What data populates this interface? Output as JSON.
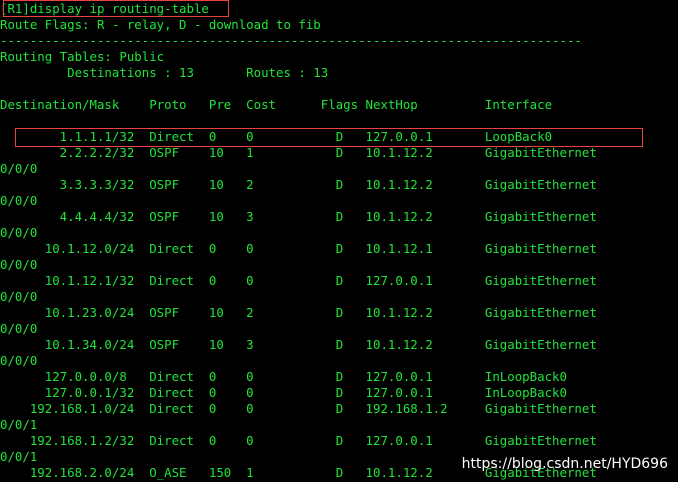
{
  "terminal": {
    "lines": [
      "[R1]display ip routing-table",
      "Route Flags: R - relay, D - download to fib",
      "------------------------------------------------------------------------------",
      "Routing Tables: Public",
      "         Destinations : 13       Routes : 13",
      "",
      "Destination/Mask    Proto   Pre  Cost      Flags NextHop         Interface",
      "",
      "        1.1.1.1/32  Direct  0    0           D   127.0.0.1       LoopBack0",
      "        2.2.2.2/32  OSPF    10   1           D   10.1.12.2       GigabitEthernet",
      "0/0/0",
      "        3.3.3.3/32  OSPF    10   2           D   10.1.12.2       GigabitEthernet",
      "0/0/0",
      "        4.4.4.4/32  OSPF    10   3           D   10.1.12.2       GigabitEthernet",
      "0/0/0",
      "      10.1.12.0/24  Direct  0    0           D   10.1.12.1       GigabitEthernet",
      "0/0/0",
      "      10.1.12.1/32  Direct  0    0           D   127.0.0.1       GigabitEthernet",
      "0/0/0",
      "      10.1.23.0/24  OSPF    10   2           D   10.1.12.2       GigabitEthernet",
      "0/0/0",
      "      10.1.34.0/24  OSPF    10   3           D   10.1.12.2       GigabitEthernet",
      "0/0/0",
      "      127.0.0.0/8   Direct  0    0           D   127.0.0.1       InLoopBack0",
      "      127.0.0.1/32  Direct  0    0           D   127.0.0.1       InLoopBack0",
      "    192.168.1.0/24  Direct  0    0           D   192.168.1.2     GigabitEthernet",
      "0/0/1",
      "    192.168.1.2/32  Direct  0    0           D   127.0.0.1       GigabitEthernet",
      "0/0/1",
      "    192.168.2.0/24  O_ASE   150  1           D   10.1.12.2       GigabitEthernet"
    ]
  },
  "watermark": "https://blog.csdn.net/HYD696",
  "colors": {
    "background": "#000000",
    "text": "#22e33a",
    "highlight": "#e8433d"
  }
}
